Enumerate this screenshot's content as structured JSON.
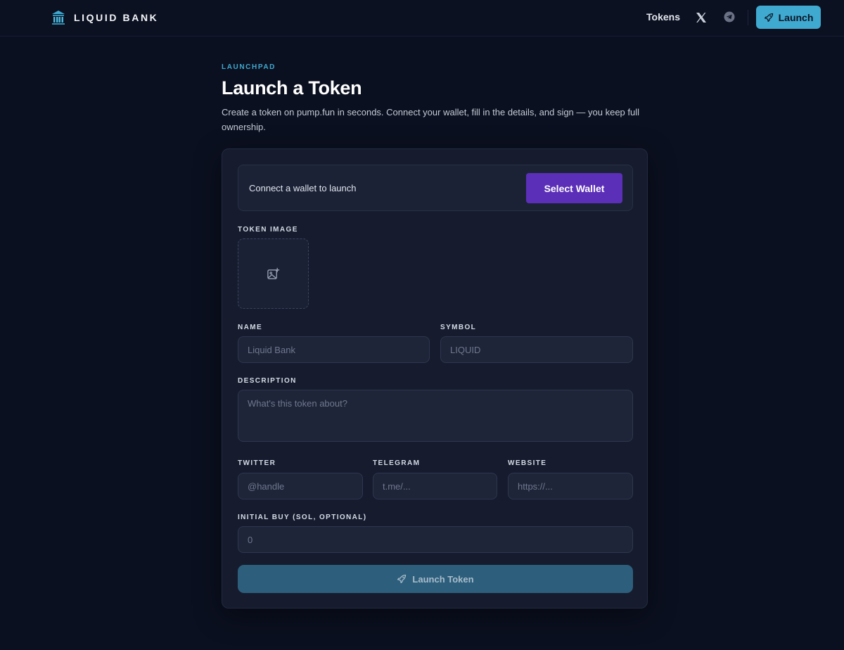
{
  "header": {
    "brand_name": "LIQUID BANK",
    "nav_tokens": "Tokens",
    "launch_label": "Launch"
  },
  "hero": {
    "eyebrow": "LAUNCHPAD",
    "title": "Launch a Token",
    "subtitle": "Create a token on pump.fun in seconds. Connect your wallet, fill in the details, and sign — you keep full ownership."
  },
  "wallet": {
    "message": "Connect a wallet to launch",
    "button_label": "Select Wallet"
  },
  "form": {
    "token_image_label": "TOKEN IMAGE",
    "name_label": "NAME",
    "name_placeholder": "Liquid Bank",
    "name_value": "",
    "symbol_label": "SYMBOL",
    "symbol_placeholder": "LIQUID",
    "symbol_value": "",
    "description_label": "DESCRIPTION",
    "description_placeholder": "What's this token about?",
    "twitter_label": "TWITTER",
    "twitter_placeholder": "@handle",
    "telegram_label": "TELEGRAM",
    "telegram_placeholder": "t.me/...",
    "website_label": "WEBSITE",
    "website_placeholder": "https://...",
    "initial_buy_label": "INITIAL BUY (SOL, OPTIONAL)",
    "initial_buy_placeholder": "0",
    "submit_label": "Launch Token"
  },
  "colors": {
    "background": "#0b1020",
    "accent": "#3fa9cf",
    "wallet_button": "#5b2fb8",
    "card": "#161c2e"
  },
  "icons": {
    "brand": "bank-columns-icon",
    "x": "x-logo-icon",
    "telegram": "telegram-icon",
    "rocket": "rocket-icon",
    "image_upload": "image-plus-icon"
  }
}
